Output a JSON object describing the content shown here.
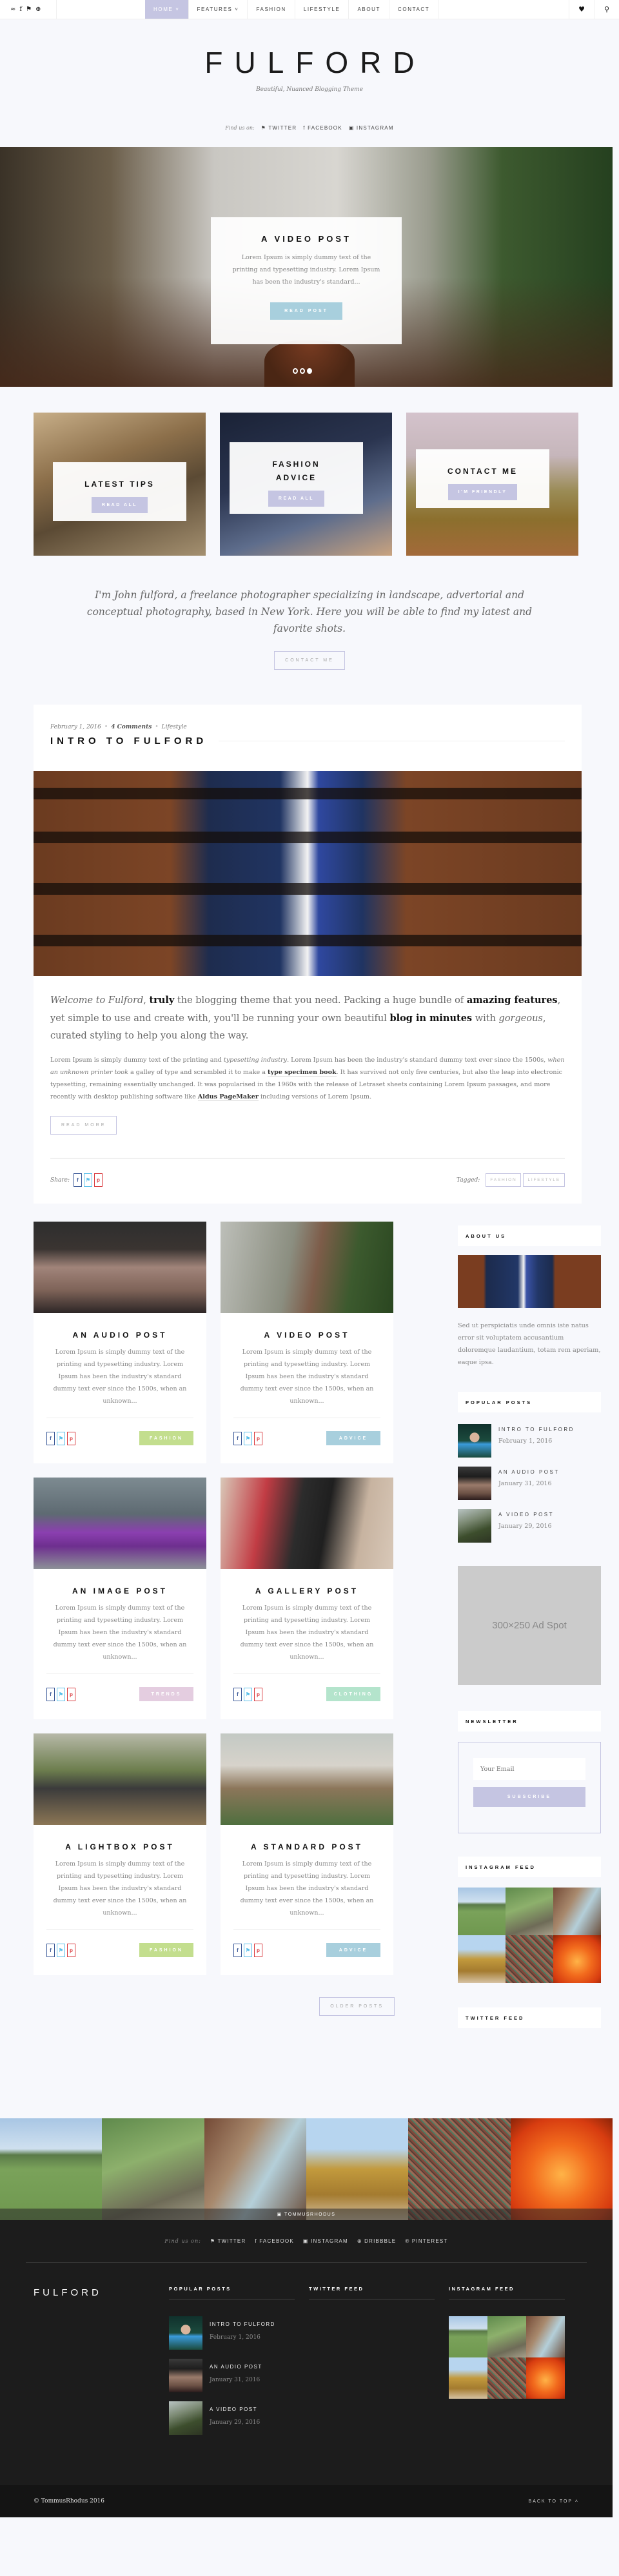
{
  "topnav": {
    "social_icons": [
      "rss-icon",
      "facebook-icon",
      "twitter-icon",
      "dribbble-icon"
    ],
    "social_glyphs": [
      "≈",
      "f",
      "⚑",
      "⊕"
    ],
    "menu": [
      {
        "label": "HOME",
        "has_dropdown": true,
        "active": true
      },
      {
        "label": "FEATURES",
        "has_dropdown": true,
        "active": false
      },
      {
        "label": "FASHION",
        "has_dropdown": false,
        "active": false
      },
      {
        "label": "LIFESTYLE",
        "has_dropdown": false,
        "active": false
      },
      {
        "label": "ABOUT",
        "has_dropdown": false,
        "active": false
      },
      {
        "label": "CONTACT",
        "has_dropdown": false,
        "active": false
      }
    ],
    "home_label": "HOME ˅",
    "features_label": "FEATURES ˅",
    "fashion_label": "FASHION",
    "lifestyle_label": "LIFESTYLE",
    "about_label": "ABOUT",
    "contact_label": "CONTACT",
    "heart_glyph": "♥",
    "search_glyph": "⚲"
  },
  "header": {
    "logo": "FULFORD",
    "tagline": "Beautiful, Nuanced Blogging Theme",
    "find_us_label": "Find us on:",
    "links": [
      "⚑ TWITTER",
      "f FACEBOOK",
      "▣ INSTAGRAM"
    ]
  },
  "hero": {
    "title": "A VIDEO POST",
    "excerpt": "Lorem Ipsum is simply dummy text of the printing and typesetting industry. Lorem Ipsum has been the industry's standard...",
    "button": "READ POST",
    "slides": 3,
    "active_slide": 3
  },
  "promos": [
    {
      "title": "LATEST TIPS",
      "button": "READ ALL"
    },
    {
      "title": "FASHION ADVICE",
      "title_line1": "FASHION",
      "title_line2": "ADVICE",
      "button": "READ ALL"
    },
    {
      "title": "CONTACT ME",
      "button": "I'M FRIENDLY"
    }
  ],
  "intro": {
    "text": "I'm John fulford, a freelance photographer specializing in landscape, advertorial and conceptual photography, based in New York. Here you will be able to find my latest and favorite shots.",
    "button": "CONTACT ME"
  },
  "featured": {
    "date": "February 1, 2016",
    "comments": "4 Comments",
    "category": "Lifestyle",
    "title": "INTRO TO FULFORD",
    "lead": {
      "p1": "Welcome to Fulford",
      "p2": ", ",
      "p3": "truly",
      "p4": " the blogging theme that you need. Packing a huge bundle of ",
      "p5": "amazing features",
      "p6": ", yet simple to use and create with, you'll be running your own beautiful ",
      "p7": "blog in minutes",
      "p8": " with ",
      "p9": "gorgeous",
      "p10": ", curated styling to help you along the way."
    },
    "text": {
      "p1": "Lorem Ipsum is simply dummy text of the printing and ",
      "p2": "typesetting industry",
      "p3": ". Lorem Ipsum has been the industry's standard dummy text ever since the 1500s, ",
      "p4": "when an unknown printer took",
      "p5": " a galley of type and scrambled it to make a ",
      "p6": "type specimen book",
      "p7": ". It has survived not only five centuries, but also the leap into electronic typesetting, remaining essentially unchanged. It was popularised in the 1960s with the release of Letraset sheets containing Lorem Ipsum passages, and more recently with desktop publishing software like ",
      "p8": "Aldus PageMaker",
      "p9": " including versions of Lorem Ipsum."
    },
    "read_more": "READ MORE",
    "share_label": "Share:",
    "tagged_label": "Tagged:",
    "tags": [
      "FASHION",
      "LIFESTYLE"
    ]
  },
  "share_glyphs": {
    "facebook": "f",
    "twitter": "⚑",
    "pinterest": "p"
  },
  "posts": [
    {
      "title": "AN AUDIO POST",
      "excerpt": "Lorem Ipsum is simply dummy text of the printing and typesetting industry. Lorem Ipsum has been the industry's standard dummy text ever since the 1500s, when an unknown...",
      "category": "FASHION",
      "category_color": "#c3de8e"
    },
    {
      "title": "A VIDEO POST",
      "excerpt": "Lorem Ipsum is simply dummy text of the printing and typesetting industry. Lorem Ipsum has been the industry's standard dummy text ever since the 1500s, when an unknown...",
      "category": "ADVICE",
      "category_color": "#a8cfdd"
    },
    {
      "title": "AN IMAGE POST",
      "excerpt": "Lorem Ipsum is simply dummy text of the printing and typesetting industry. Lorem Ipsum has been the industry's standard dummy text ever since the 1500s, when an unknown...",
      "category": "TRENDS",
      "category_color": "#e4cde0"
    },
    {
      "title": "A GALLERY POST",
      "excerpt": "Lorem Ipsum is simply dummy text of the printing and typesetting industry. Lorem Ipsum has been the industry's standard dummy text ever since the 1500s, when an unknown...",
      "category": "CLOTHING",
      "category_color": "#b4e4cc"
    },
    {
      "title": "A LIGHTBOX POST",
      "excerpt": "Lorem Ipsum is simply dummy text of the printing and typesetting industry. Lorem Ipsum has been the industry's standard dummy text ever since the 1500s, when an unknown...",
      "category": "FASHION",
      "category_color": "#c3de8e"
    },
    {
      "title": "A STANDARD POST",
      "excerpt": "Lorem Ipsum is simply dummy text of the printing and typesetting industry. Lorem Ipsum has been the industry's standard dummy text ever since the 1500s, when an unknown...",
      "category": "ADVICE",
      "category_color": "#a8cfdd"
    }
  ],
  "older_posts": "OLDER POSTS",
  "sidebar": {
    "about_title": "ABOUT US",
    "about_text": "Sed ut perspiciatis unde omnis iste natus error sit voluptatem accusantium doloremque laudantium, totam rem aperiam, eaque ipsa.",
    "popular_title": "POPULAR POSTS",
    "popular": [
      {
        "title": "INTRO TO FULFORD",
        "date": "February 1, 2016"
      },
      {
        "title": "AN AUDIO POST",
        "date": "January 31, 2016"
      },
      {
        "title": "A VIDEO POST",
        "date": "January 29, 2016"
      }
    ],
    "ad_text": "300×250 Ad Spot",
    "newsletter_title": "NEWSLETTER",
    "email_placeholder": "Your Email",
    "subscribe": "SUBSCRIBE",
    "instagram_title": "INSTAGRAM FEED",
    "twitter_title": "TWITTER FEED"
  },
  "instagram_strip": {
    "handle": "▣ TOMMUSRHODUS"
  },
  "footer": {
    "find_us_label": "Find us on:",
    "links": [
      "⚑ TWITTER",
      "f FACEBOOK",
      "▣ INSTAGRAM",
      "⊕ DRIBBBLE",
      "℗ PINTEREST"
    ],
    "logo": "FULFORD",
    "popular_title": "POPULAR POSTS",
    "twitter_title": "TWITTER FEED",
    "instagram_title": "INSTAGRAM FEED",
    "popular": [
      {
        "title": "INTRO TO FULFORD",
        "date": "February 1, 2016"
      },
      {
        "title": "AN AUDIO POST",
        "date": "January 31, 2016"
      },
      {
        "title": "A VIDEO POST",
        "date": "January 29, 2016"
      }
    ],
    "copyright": "© TommusRhodus 2016",
    "back_to_top": "BACK TO TOP ˄"
  },
  "colors": {
    "accent_lavender": "#c5c5e2",
    "accent_blue": "#a8cfdd",
    "background": "#f7f8fc",
    "footer_dark": "#1c1c1c"
  }
}
